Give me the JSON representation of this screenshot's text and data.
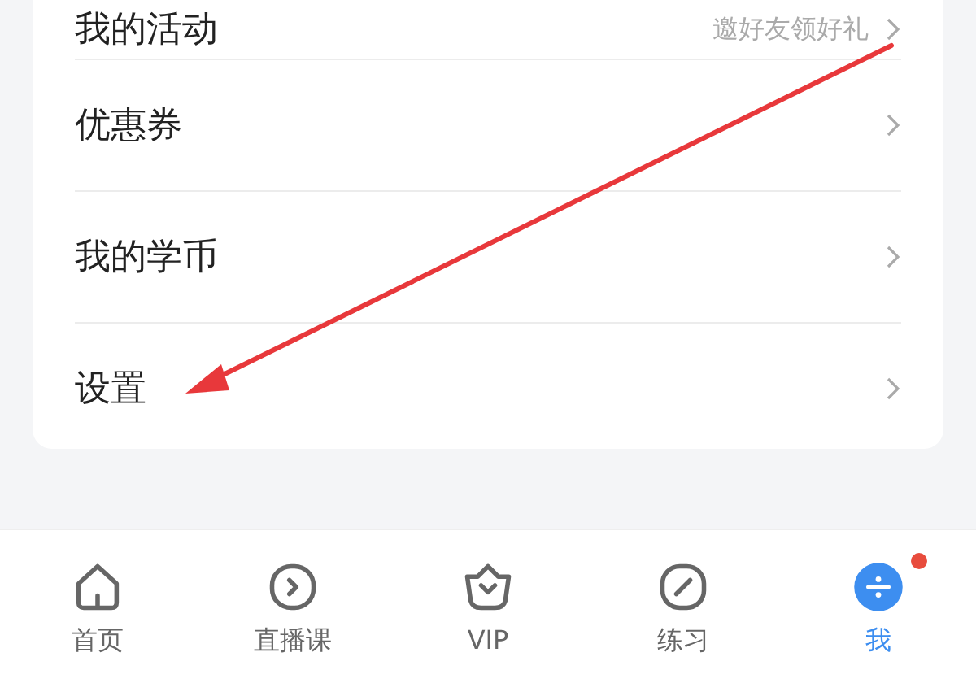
{
  "menu": [
    {
      "label": "我的活动",
      "hint": "邀好友领好礼"
    },
    {
      "label": "优惠券"
    },
    {
      "label": "我的学币"
    },
    {
      "label": "设置"
    }
  ],
  "annotation": {
    "kind": "arrow"
  },
  "tabbar": [
    {
      "kind": "home",
      "label": "首页",
      "selected": false,
      "dot": false
    },
    {
      "kind": "live",
      "label": "直播课",
      "selected": false,
      "dot": false
    },
    {
      "kind": "vip",
      "label": "VIP",
      "selected": false,
      "dot": false
    },
    {
      "kind": "practice",
      "label": "练习",
      "selected": false,
      "dot": false
    },
    {
      "kind": "me",
      "label": "我",
      "selected": true,
      "dot": true
    }
  ]
}
